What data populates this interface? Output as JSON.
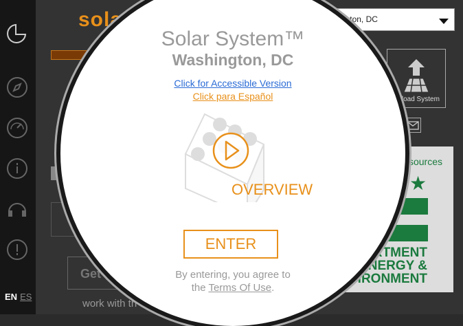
{
  "sidebar": {
    "icons": [
      "pie-chart-icon",
      "compass-icon",
      "gauge-icon",
      "info-icon",
      "headset-icon",
      "alert-icon"
    ],
    "lang_en": "EN",
    "lang_es": "ES"
  },
  "background": {
    "brand": "solar",
    "get_button": "Get",
    "work_text": "work with th",
    "location_select": "Washington, DC",
    "upload_label": "Upload System",
    "dc_resources": "Resources",
    "dc_line1": "PARTMENT",
    "dc_line2": "ENERGY &",
    "dc_line3": "VIRONMENT"
  },
  "modal": {
    "title": "Solar System™",
    "subtitle": "Washington, DC",
    "accessible_link": "Click for Accessible Version",
    "spanish_link": "Click para Español",
    "overview_label": "OVERVIEW",
    "enter_button": "ENTER",
    "agree_line1": "By entering, you agree to",
    "agree_prefix": "the ",
    "terms_link": "Terms Of Use",
    "agree_suffix": "."
  },
  "colors": {
    "accent": "#e8901a",
    "link_blue": "#2a6bd6",
    "dc_green": "#1b7a3e"
  }
}
